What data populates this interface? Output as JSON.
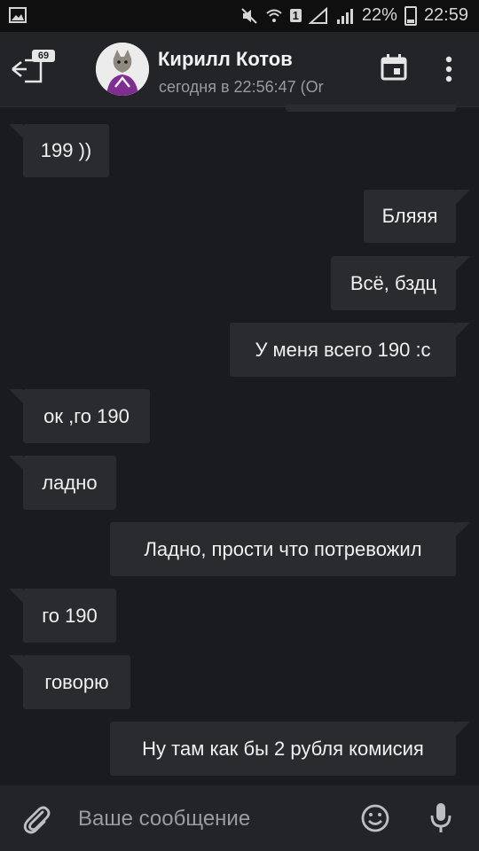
{
  "status_bar": {
    "battery": "22%",
    "time": "22:59",
    "sim_label": "1"
  },
  "header": {
    "unread_count": "69",
    "contact_name": "Кирилл Котов",
    "last_seen": "сегодня в 22:56:47 (Or"
  },
  "messages": [
    {
      "text": "199 ))",
      "direction": "in"
    },
    {
      "text": "Бляяя",
      "direction": "out"
    },
    {
      "text": "Всё, бздц",
      "direction": "out"
    },
    {
      "text": "У меня всего 190 :c",
      "direction": "out"
    },
    {
      "text": "ок ,го 190",
      "direction": "in"
    },
    {
      "text": "ладно",
      "direction": "in"
    },
    {
      "text": "Ладно, прости что потревожил",
      "direction": "out"
    },
    {
      "text": "го 190",
      "direction": "in"
    },
    {
      "text": "говорю",
      "direction": "in"
    },
    {
      "text": "Ну там как бы 2 рубля комисия",
      "direction": "out"
    }
  ],
  "composer": {
    "placeholder": "Ваше сообщение"
  },
  "icons": {
    "back": "back-arrow-icon",
    "calendar": "calendar-icon",
    "more": "more-vertical-icon",
    "attach": "paperclip-icon",
    "emoji": "emoji-icon",
    "mic": "microphone-icon"
  },
  "colors": {
    "background": "#1a1b1e",
    "bubble": "#2a2b2f",
    "header": "#232427"
  }
}
